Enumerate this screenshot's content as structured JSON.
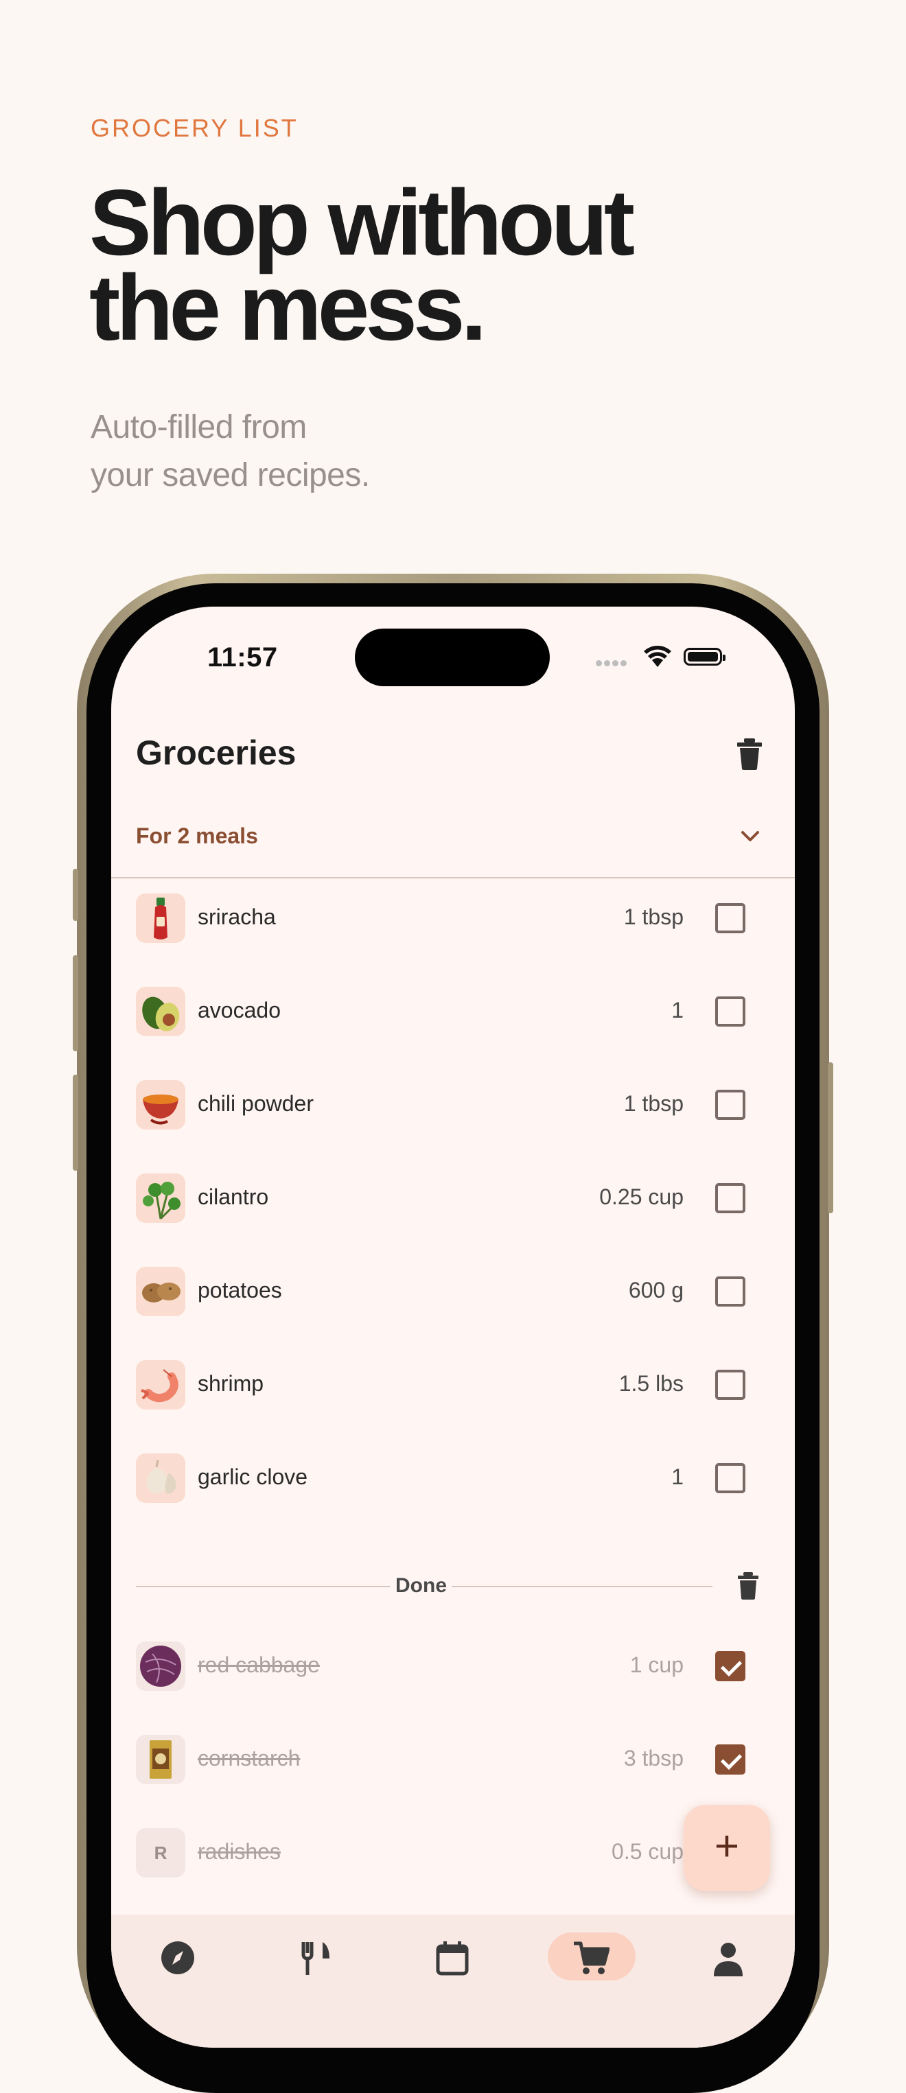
{
  "promo": {
    "kicker": "GROCERY LIST",
    "headline_line1": "Shop without",
    "headline_line2": "the mess.",
    "subline_line1": "Auto-filled from",
    "subline_line2": "your saved recipes."
  },
  "status_bar": {
    "time": "11:57"
  },
  "app": {
    "title": "Groceries",
    "meals_filter": "For 2 meals",
    "done_label": "Done",
    "add_button_label": "+"
  },
  "items": [
    {
      "name": "sriracha",
      "qty": "1 tbsp",
      "checked": false,
      "icon": "sriracha-bottle"
    },
    {
      "name": "avocado",
      "qty": "1",
      "checked": false,
      "icon": "avocado"
    },
    {
      "name": "chili powder",
      "qty": "1 tbsp",
      "checked": false,
      "icon": "chili-powder-bowl"
    },
    {
      "name": "cilantro",
      "qty": "0.25 cup",
      "checked": false,
      "icon": "cilantro"
    },
    {
      "name": "potatoes",
      "qty": "600 g",
      "checked": false,
      "icon": "potatoes"
    },
    {
      "name": "shrimp",
      "qty": "1.5 lbs",
      "checked": false,
      "icon": "shrimp"
    },
    {
      "name": "garlic clove",
      "qty": "1",
      "checked": false,
      "icon": "garlic"
    }
  ],
  "done_items": [
    {
      "name": "red cabbage",
      "qty": "1 cup",
      "checked": true,
      "icon": "red-cabbage"
    },
    {
      "name": "cornstarch",
      "qty": "3 tbsp",
      "checked": true,
      "icon": "cornstarch-box"
    },
    {
      "name": "radishes",
      "qty": "0.5 cup",
      "checked": true,
      "icon_letter": "R"
    }
  ],
  "nav": [
    {
      "icon": "compass-icon",
      "active": false
    },
    {
      "icon": "fork-knife-icon",
      "active": false
    },
    {
      "icon": "calendar-icon",
      "active": false
    },
    {
      "icon": "cart-icon",
      "active": true
    },
    {
      "icon": "person-icon",
      "active": false
    }
  ],
  "colors": {
    "accent": "#e0773f",
    "brand_brown": "#8a4e33",
    "background": "#fcf7f3",
    "screen_bg": "#fff5f2"
  }
}
